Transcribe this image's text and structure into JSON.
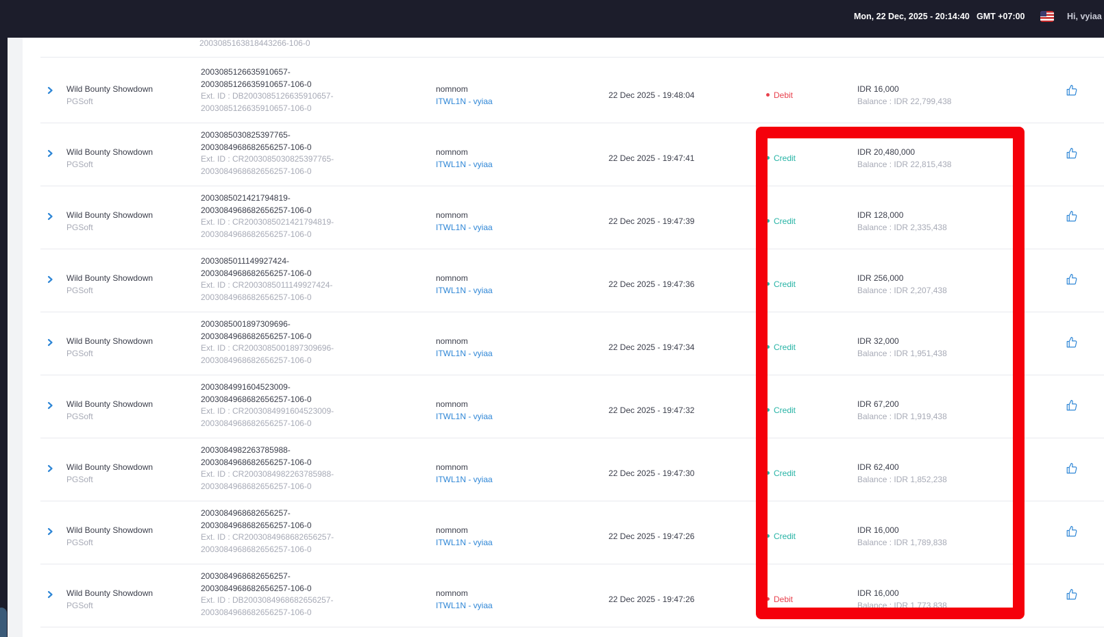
{
  "header": {
    "datetime": "Mon, 22 Dec, 2025 - 20:14:40",
    "timezone": "GMT +07:00",
    "greeting": "Hi, vyiaa"
  },
  "top_partial_row": {
    "text": "2003085163818443266-106-0"
  },
  "rows": [
    {
      "game": "Wild Bounty Showdown",
      "provider": "PGSoft",
      "tx1": "2003085126635910657-",
      "tx2": "2003085126635910657-106-0",
      "ext1": "Ext. ID : DB2003085126635910657-",
      "ext2": "2003085126635910657-106-0",
      "player": "nomnom",
      "account": "ITWL1N - vyiaa",
      "date": "22 Dec 2025 - 19:48:04",
      "type": "Debit",
      "amount": "IDR 16,000",
      "balance": "Balance : IDR 22,799,438"
    },
    {
      "game": "Wild Bounty Showdown",
      "provider": "PGSoft",
      "tx1": "2003085030825397765-",
      "tx2": "2003084968682656257-106-0",
      "ext1": "Ext. ID : CR2003085030825397765-",
      "ext2": "2003084968682656257-106-0",
      "player": "nomnom",
      "account": "ITWL1N - vyiaa",
      "date": "22 Dec 2025 - 19:47:41",
      "type": "Credit",
      "amount": "IDR 20,480,000",
      "balance": "Balance : IDR 22,815,438"
    },
    {
      "game": "Wild Bounty Showdown",
      "provider": "PGSoft",
      "tx1": "2003085021421794819-",
      "tx2": "2003084968682656257-106-0",
      "ext1": "Ext. ID : CR2003085021421794819-",
      "ext2": "2003084968682656257-106-0",
      "player": "nomnom",
      "account": "ITWL1N - vyiaa",
      "date": "22 Dec 2025 - 19:47:39",
      "type": "Credit",
      "amount": "IDR 128,000",
      "balance": "Balance : IDR 2,335,438"
    },
    {
      "game": "Wild Bounty Showdown",
      "provider": "PGSoft",
      "tx1": "2003085011149927424-",
      "tx2": "2003084968682656257-106-0",
      "ext1": "Ext. ID : CR2003085011149927424-",
      "ext2": "2003084968682656257-106-0",
      "player": "nomnom",
      "account": "ITWL1N - vyiaa",
      "date": "22 Dec 2025 - 19:47:36",
      "type": "Credit",
      "amount": "IDR 256,000",
      "balance": "Balance : IDR 2,207,438"
    },
    {
      "game": "Wild Bounty Showdown",
      "provider": "PGSoft",
      "tx1": "2003085001897309696-",
      "tx2": "2003084968682656257-106-0",
      "ext1": "Ext. ID : CR2003085001897309696-",
      "ext2": "2003084968682656257-106-0",
      "player": "nomnom",
      "account": "ITWL1N - vyiaa",
      "date": "22 Dec 2025 - 19:47:34",
      "type": "Credit",
      "amount": "IDR 32,000",
      "balance": "Balance : IDR 1,951,438"
    },
    {
      "game": "Wild Bounty Showdown",
      "provider": "PGSoft",
      "tx1": "2003084991604523009-",
      "tx2": "2003084968682656257-106-0",
      "ext1": "Ext. ID : CR2003084991604523009-",
      "ext2": "2003084968682656257-106-0",
      "player": "nomnom",
      "account": "ITWL1N - vyiaa",
      "date": "22 Dec 2025 - 19:47:32",
      "type": "Credit",
      "amount": "IDR 67,200",
      "balance": "Balance : IDR 1,919,438"
    },
    {
      "game": "Wild Bounty Showdown",
      "provider": "PGSoft",
      "tx1": "2003084982263785988-",
      "tx2": "2003084968682656257-106-0",
      "ext1": "Ext. ID : CR2003084982263785988-",
      "ext2": "2003084968682656257-106-0",
      "player": "nomnom",
      "account": "ITWL1N - vyiaa",
      "date": "22 Dec 2025 - 19:47:30",
      "type": "Credit",
      "amount": "IDR 62,400",
      "balance": "Balance : IDR 1,852,238"
    },
    {
      "game": "Wild Bounty Showdown",
      "provider": "PGSoft",
      "tx1": "2003084968682656257-",
      "tx2": "2003084968682656257-106-0",
      "ext1": "Ext. ID : CR2003084968682656257-",
      "ext2": "2003084968682656257-106-0",
      "player": "nomnom",
      "account": "ITWL1N - vyiaa",
      "date": "22 Dec 2025 - 19:47:26",
      "type": "Credit",
      "amount": "IDR 16,000",
      "balance": "Balance : IDR 1,789,838"
    },
    {
      "game": "Wild Bounty Showdown",
      "provider": "PGSoft",
      "tx1": "2003084968682656257-",
      "tx2": "2003084968682656257-106-0",
      "ext1": "Ext. ID : DB2003084968682656257-",
      "ext2": "2003084968682656257-106-0",
      "player": "nomnom",
      "account": "ITWL1N - vyiaa",
      "date": "22 Dec 2025 - 19:47:26",
      "type": "Debit",
      "amount": "IDR 16,000",
      "balance": "Balance : IDR 1,773,838"
    }
  ],
  "colors": {
    "header_bg": "#1c1d2b",
    "credit": "#26b3a5",
    "debit": "#e8414d",
    "link": "#2e86d6",
    "highlight_box": "#f5000b"
  },
  "icons": {
    "expand": "chevron-right-icon",
    "action": "thumbs-up-icon",
    "locale": "us-flag-icon"
  }
}
